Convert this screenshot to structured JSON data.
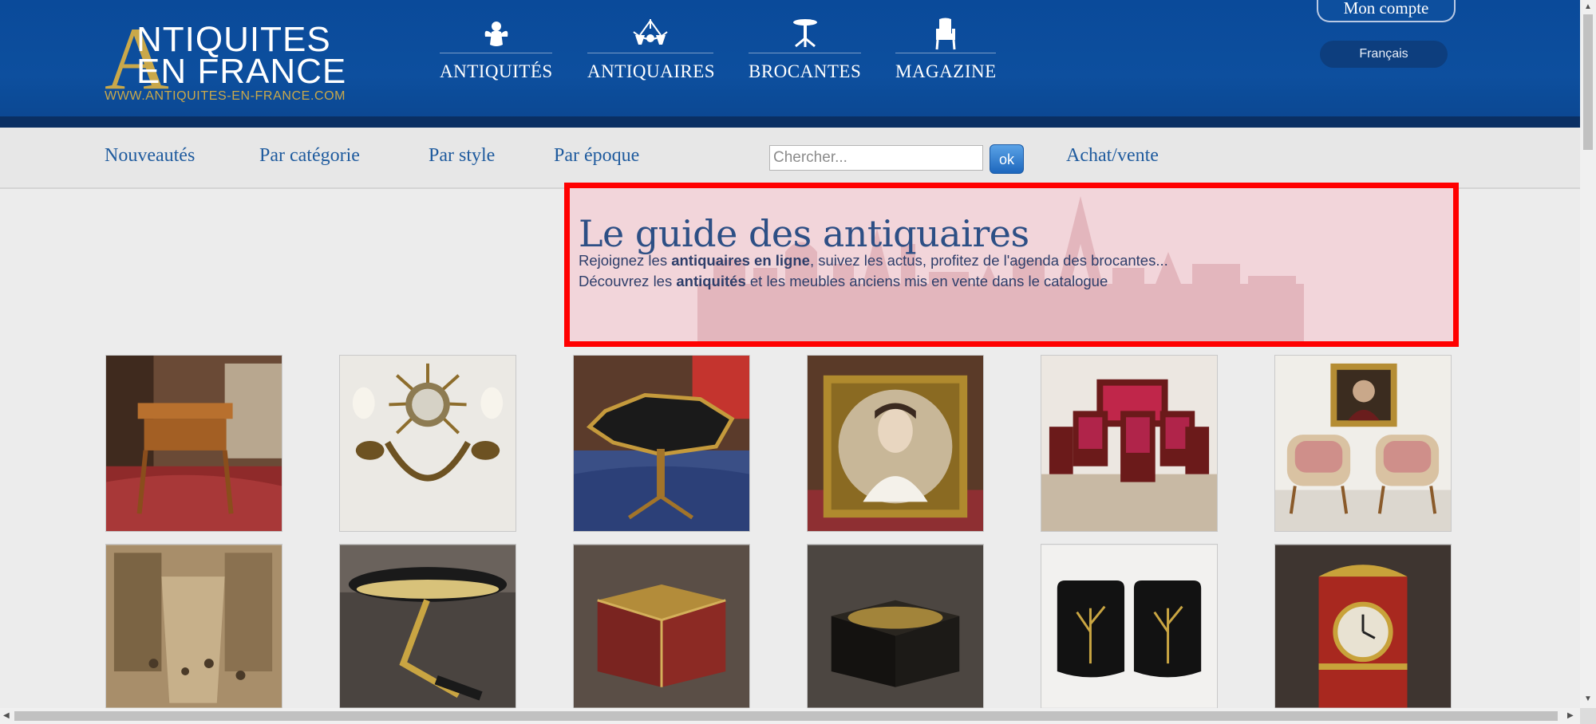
{
  "logo": {
    "letter_a": "A",
    "line1": "NTIQUITES",
    "line2": "EN FRANCE",
    "url": "WWW.ANTIQUITES-EN-FRANCE.COM"
  },
  "main_nav": [
    {
      "label": "ANTIQUITÉS",
      "icon": "cherub-icon"
    },
    {
      "label": "ANTIQUAIRES",
      "icon": "chandelier-icon"
    },
    {
      "label": "BROCANTES",
      "icon": "gueridon-table-icon"
    },
    {
      "label": "MAGAZINE",
      "icon": "armchair-icon"
    }
  ],
  "account": {
    "label": "Mon compte"
  },
  "language": {
    "label": "Français"
  },
  "sub_nav": {
    "items": [
      "Nouveautés",
      "Par catégorie",
      "Par style",
      "Par époque"
    ],
    "search_placeholder": "Chercher...",
    "search_button": "ok",
    "achat_vente": "Achat/vente"
  },
  "hero": {
    "title": "Le guide des antiquaires",
    "line1_pre": "Rejoignez les ",
    "line1_bold": "antiquaires en ligne",
    "line1_post": ", suivez les actus, profitez de l'agenda des brocantes...",
    "line2_pre": "Découvrez les ",
    "line2_bold": "antiquités",
    "line2_post": " et les meubles anciens mis en vente dans le catalogue"
  },
  "products": [
    {
      "subject": "small-table-photo"
    },
    {
      "subject": "sunburst-mirror-sconce-photo"
    },
    {
      "subject": "octagonal-table-photo"
    },
    {
      "subject": "portrait-painting-photo"
    },
    {
      "subject": "red-salon-set-photo"
    },
    {
      "subject": "armchairs-with-portrait-photo"
    },
    {
      "subject": "street-painting-photo"
    },
    {
      "subject": "desk-lamp-photo"
    },
    {
      "subject": "boulle-box-photo"
    },
    {
      "subject": "black-box-photo"
    },
    {
      "subject": "lacquer-panels-photo"
    },
    {
      "subject": "boulle-clock-photo"
    }
  ],
  "colors": {
    "header_blue": "#0d4f9e",
    "gold": "#c9a84a",
    "link_blue": "#1f5b9e",
    "highlight_border": "#ff0000"
  }
}
